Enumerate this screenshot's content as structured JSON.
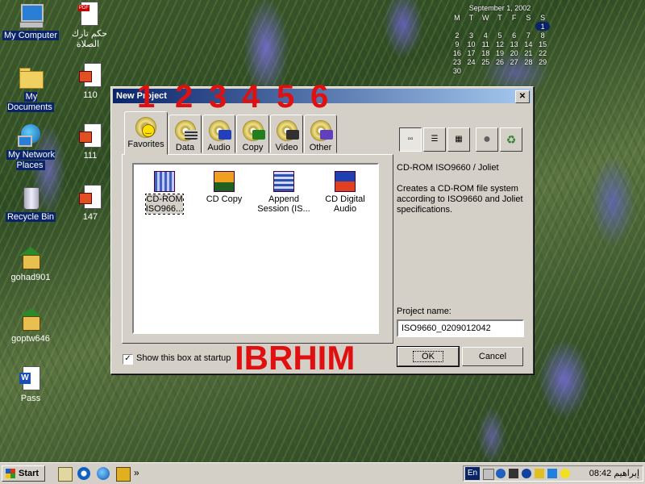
{
  "desktop": {
    "icons": {
      "my_computer": "My Computer",
      "pdf_file": "حكم تارك الصلاة",
      "pdf_tag": "PDF",
      "my_documents": "My Documents",
      "shortcut_110": "110",
      "my_network_places": "My Network Places",
      "shortcut_111": "111",
      "recycle_bin": "Recycle Bin",
      "shortcut_147": "147",
      "gohad901": "gohad901",
      "goptw646": "goptw646",
      "pass_doc": "Pass",
      "word_badge": "W"
    }
  },
  "calendar": {
    "title": "September 1, 2002",
    "weekdays": [
      "M",
      "T",
      "W",
      "T",
      "F",
      "S",
      "S"
    ],
    "rows": [
      [
        "",
        "",
        "",
        "",
        "",
        "",
        "1"
      ],
      [
        "2",
        "3",
        "4",
        "5",
        "6",
        "7",
        "8"
      ],
      [
        "9",
        "10",
        "11",
        "12",
        "13",
        "14",
        "15"
      ],
      [
        "16",
        "17",
        "18",
        "19",
        "20",
        "21",
        "22"
      ],
      [
        "23",
        "24",
        "25",
        "26",
        "27",
        "28",
        "29"
      ],
      [
        "30",
        "",
        "",
        "",
        "",
        "",
        ""
      ]
    ]
  },
  "dialog": {
    "title": "New Project",
    "close_glyph": "✕",
    "tabs": [
      "Favorites",
      "Data",
      "Audio",
      "Copy",
      "Video",
      "Other"
    ],
    "projects": [
      {
        "label": "CD-ROM ISO966..."
      },
      {
        "label": "CD Copy"
      },
      {
        "label": "Append Session (IS..."
      },
      {
        "label": "CD Digital Audio"
      }
    ],
    "view_buttons": {
      "large": "▫▫",
      "list": "☰",
      "details": "▦",
      "record": "●",
      "recycle": "♻"
    },
    "description_title": "CD-ROM ISO9660 / Joliet",
    "description_text": "Creates a CD-ROM file system according to ISO9660 and Joliet specifications.",
    "project_name_label": "Project name:",
    "project_name_value": "ISO9660_0209012042",
    "ok_label": "OK",
    "cancel_label": "Cancel",
    "startup_label": "Show this box at startup",
    "startup_checked": "✓"
  },
  "annotations": {
    "numbers": [
      "1",
      "2",
      "3",
      "4",
      "5",
      "6"
    ],
    "name": "IBRHIM"
  },
  "taskbar": {
    "start_label": "Start",
    "chevron": "»",
    "language": "En",
    "clock": "08:42 إبراهيم"
  },
  "colors": {
    "title_bar_start": "#0a246a",
    "title_bar_end": "#a6caf0",
    "annotation_red": "#e01010",
    "face": "#d4d0c8"
  }
}
